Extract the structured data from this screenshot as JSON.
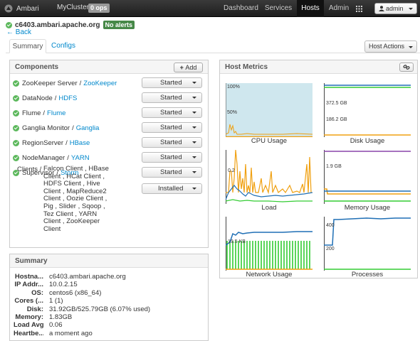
{
  "nav": {
    "brand": "Ambari",
    "cluster": "MyCluster",
    "ops_badge": "0 ops",
    "items": [
      "Dashboard",
      "Services",
      "Hosts",
      "Admin"
    ],
    "active": "Hosts",
    "user": "admin"
  },
  "host": {
    "name": "c6403.ambari.apache.org",
    "alerts": "No alerts",
    "back": "Back"
  },
  "tabs": [
    "Summary",
    "Configs"
  ],
  "host_actions": "Host Actions",
  "components": {
    "title": "Components",
    "add_label": "Add",
    "items": [
      {
        "name": "ZooKeeper Server",
        "service": "ZooKeeper",
        "state": "Started"
      },
      {
        "name": "DataNode",
        "service": "HDFS",
        "state": "Started"
      },
      {
        "name": "Flume",
        "service": "Flume",
        "state": "Started"
      },
      {
        "name": "Ganglia Monitor",
        "service": "Ganglia",
        "state": "Started"
      },
      {
        "name": "RegionServer",
        "service": "HBase",
        "state": "Started"
      },
      {
        "name": "NodeManager",
        "service": "YARN",
        "state": "Started"
      },
      {
        "name": "Supervisor",
        "service": "Storm",
        "state": "Started"
      }
    ],
    "clients_label": "Clients /",
    "clients_list": "Falcon Client , HBase Client , HCat Client , HDFS Client , Hive Client , MapReduce2 Client , Oozie Client , Pig , Slider , Sqoop , Tez Client , YARN Client , ZooKeeper Client",
    "clients_state": "Installed"
  },
  "summary": {
    "title": "Summary",
    "rows": [
      {
        "key": "Hostna...",
        "value": "c6403.ambari.apache.org"
      },
      {
        "key": "IP Addr...",
        "value": "10.0.2.15"
      },
      {
        "key": "OS:",
        "value": "centos6 (x86_64)"
      },
      {
        "key": "Cores (...",
        "value": "1 (1)"
      },
      {
        "key": "Disk:",
        "value": "31.92GB/525.79GB (6.07% used)"
      },
      {
        "key": "Memory:",
        "value": "1.83GB"
      },
      {
        "key": "Load Avg:",
        "value": "0.06"
      },
      {
        "key": "Heartbe...",
        "value": "a moment ago"
      }
    ]
  },
  "metrics": {
    "title": "Host Metrics",
    "graphs": [
      {
        "label": "CPU Usage",
        "ticks": [
          "100%",
          "50%"
        ]
      },
      {
        "label": "Disk Usage",
        "ticks": [
          "372.5 GB",
          "186.2 GB"
        ]
      },
      {
        "label": "Load",
        "ticks": [
          "0.2"
        ]
      },
      {
        "label": "Memory Usage",
        "ticks": [
          "1.9 GB"
        ]
      },
      {
        "label": "Network Usage",
        "ticks": [
          "19.5 KB"
        ]
      },
      {
        "label": "Processes",
        "ticks": [
          "400",
          "200"
        ]
      }
    ]
  },
  "colors": {
    "ok_green": "#5cb85c",
    "alert_badge": "#468847",
    "link_blue": "#0088cc",
    "graph_green": "#33cc33",
    "graph_blue": "#1f6fb5",
    "graph_orange": "#f0a010",
    "graph_purple": "#8844aa",
    "cpu_fill": "#cfe7ee"
  }
}
